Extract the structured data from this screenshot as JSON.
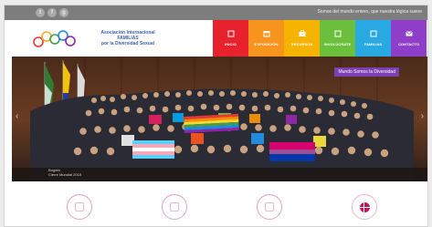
{
  "topbar": {
    "social": [
      {
        "name": "twitter-icon",
        "glyph": "t"
      },
      {
        "name": "facebook-icon",
        "glyph": "f"
      },
      {
        "name": "googleplus-icon",
        "glyph": "g"
      }
    ],
    "tagline": "Somos del mundo entero, que nuestra lógica suene"
  },
  "header": {
    "brand_line1": "Asociación Internacional",
    "brand_line2": "FAMILIAS",
    "brand_line3": "por la Diversidad Sexual",
    "logo_colors": [
      "#e53935",
      "#f9a825",
      "#43a047",
      "#1e88e5",
      "#8e24aa"
    ]
  },
  "nav": {
    "items": [
      {
        "label": "INICIO",
        "color": "#e8212e"
      },
      {
        "label": "EXPOSICIÓN",
        "color": "#f7941d"
      },
      {
        "label": "RECURSOS",
        "color": "#f4b400"
      },
      {
        "label": "INVOLÚCRATE",
        "color": "#6cbf3c"
      },
      {
        "label": "FAMILIAS",
        "color": "#29a9e1"
      },
      {
        "label": "CONTACTO",
        "color": "#8e3ec8"
      }
    ]
  },
  "hero": {
    "badge": "Mundo Somos la Diversidad",
    "caption_line1": "Bogotá",
    "caption_line2": "Cierre Mundial 2015"
  },
  "features": {
    "count": 4
  }
}
